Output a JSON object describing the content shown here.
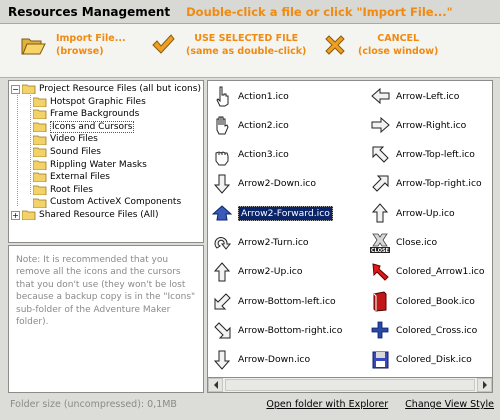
{
  "window": {
    "title": "Resources Management",
    "hint": "Double-click a file or click \"Import File...\""
  },
  "toolbar": {
    "import": {
      "line1": "Import File...",
      "line2": "(browse)"
    },
    "use": {
      "line1": "USE SELECTED FILE",
      "line2": "(same as double-click)"
    },
    "cancel": {
      "line1": "CANCEL",
      "line2": "(close window)"
    }
  },
  "tree": {
    "root_label": "Project Resource Files (all but icons)",
    "children": [
      "Hotspot Graphic Files",
      "Frame Backgrounds",
      "Icons and Cursors",
      "Video Files",
      "Sound Files",
      "Rippling Water Masks",
      "External Files",
      "Root Files",
      "Custom ActiveX Components"
    ],
    "selected_index": 2,
    "shared_label": "Shared Resource Files (All)"
  },
  "note": "Note: It is recommended that you remove all the icons and the cursors that you don't use (they won't be lost because a backup copy is in the \"Icons\" sub-folder of the Adventure Maker folder).",
  "files": {
    "col1": [
      {
        "name": "Action1.ico",
        "icon": "hand-pointer-icon"
      },
      {
        "name": "Action2.ico",
        "icon": "hand-icon"
      },
      {
        "name": "Action3.ico",
        "icon": "hand-grab-icon"
      },
      {
        "name": "Arrow2-Down.ico",
        "icon": "arrow-down-icon"
      },
      {
        "name": "Arrow2-Forward.ico",
        "icon": "arrow-forward-icon",
        "selected": true
      },
      {
        "name": "Arrow2-Turn.ico",
        "icon": "arrow-turn-icon"
      },
      {
        "name": "Arrow2-Up.ico",
        "icon": "arrow-up-icon"
      },
      {
        "name": "Arrow-Bottom-left.ico",
        "icon": "arrow-bottom-left-icon"
      },
      {
        "name": "Arrow-Bottom-right.ico",
        "icon": "arrow-bottom-right-icon"
      },
      {
        "name": "Arrow-Down.ico",
        "icon": "arrow-down-icon"
      }
    ],
    "col2": [
      {
        "name": "Arrow-Left.ico",
        "icon": "arrow-left-icon"
      },
      {
        "name": "Arrow-Right.ico",
        "icon": "arrow-right-icon"
      },
      {
        "name": "Arrow-Top-left.ico",
        "icon": "arrow-top-left-icon"
      },
      {
        "name": "Arrow-Top-right.ico",
        "icon": "arrow-top-right-icon"
      },
      {
        "name": "Arrow-Up.ico",
        "icon": "arrow-up-icon"
      },
      {
        "name": "Close.ico",
        "icon": "close-sign-icon",
        "icon_text": "CLOSE"
      },
      {
        "name": "Colored_Arrow1.ico",
        "icon": "red-arrow-icon"
      },
      {
        "name": "Colored_Book.ico",
        "icon": "book-icon"
      },
      {
        "name": "Colored_Cross.ico",
        "icon": "cross-icon"
      },
      {
        "name": "Colored_Disk.ico",
        "icon": "floppy-disk-icon"
      }
    ]
  },
  "colors": {
    "accent_orange": "#f08a10",
    "selection": "#0a246a",
    "folder": "#f4d26a"
  },
  "status": {
    "folder_size": "Folder size (uncompressed): 0,1MB"
  },
  "links": {
    "open_folder": "Open folder with Explorer",
    "change_view": "Change View Style"
  }
}
